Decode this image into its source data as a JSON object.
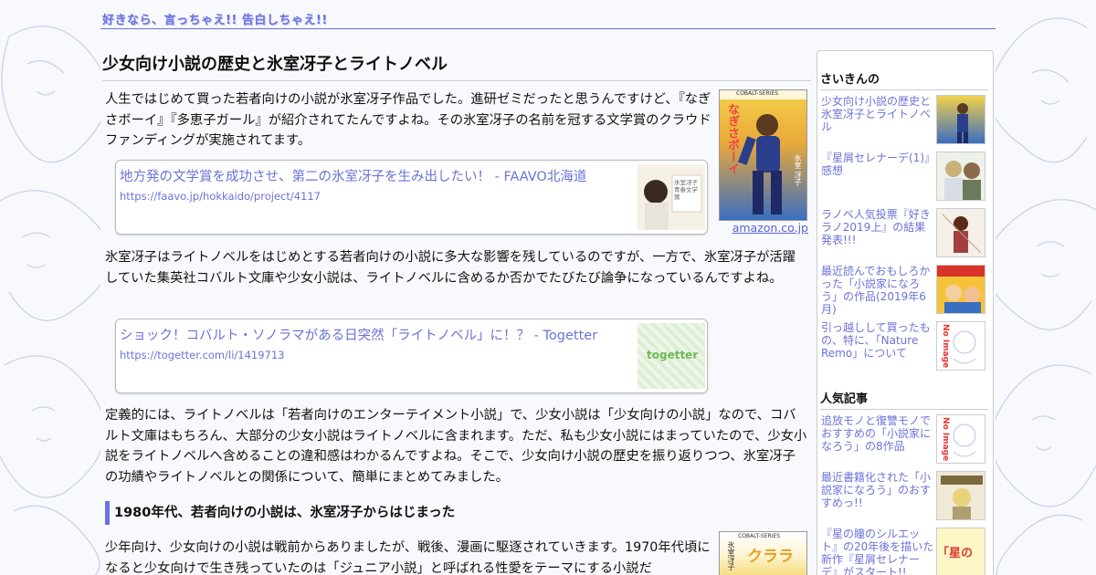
{
  "header": {
    "logo": "好きなら、言っちゃえ!! 告白しちゃえ!!"
  },
  "article": {
    "title": "少女向け小説の歴史と氷室冴子とライトノベル",
    "para1": "人生ではじめて買った若者向けの小説が氷室冴子作品でした。進研ゼミだったと思うんですけど、『なぎさボーイ』『多恵子ガール』が紹介されてたんですよね。その氷室冴子の名前を冠する文学賞のクラウドファンディングが実施されてます。",
    "book1": {
      "cover_title": "なぎさボーイ",
      "cover_series": "COBALT-SERIES",
      "cover_author": "氷室 冴子",
      "amazon": "amazon.co.jp"
    },
    "card1": {
      "title": "地方発の文学賞を成功させ、第二の氷室冴子を生み出したい！ - FAAVO北海道",
      "url": "https://faavo.jp/hokkaido/project/4117",
      "thumb_text": "氷室冴子青春文学賞"
    },
    "para2": "氷室冴子はライトノベルをはじめとする若者向けの小説に多大な影響を残しているのですが、一方で、氷室冴子が活躍していた集英社コバルト文庫や少女小説は、ライトノベルに含めるか否かでたびたび論争になっているんですよね。",
    "card2": {
      "title": "ショック！コバルト・ソノラマがある日突然「ライトノベル」に！？ - Togetter",
      "url": "https://togetter.com/li/1419713",
      "thumb_text": "togetter"
    },
    "para3": "定義的には、ライトノベルは「若者向けのエンターテイメント小説」で、少女小説は「少女向けの小説」なので、コバルト文庫はもちろん、大部分の少女小説はライトノベルに含まれます。ただ、私も少女小説にはまっていたので、少女小説をライトノベルへ含めることの違和感はわかるんですよね。そこで、少女向け小説の歴史を振り返りつつ、氷室冴子の功績やライトノベルとの関係について、簡単にまとめてみました。",
    "section1": "1980年代、若者向けの小説は、氷室冴子からはじまった",
    "para4": "少年向け、少女向けの小説は戦前からありましたが、戦後、漫画に駆逐されていきます。1970年代頃になると少女向けで生き残っていたのは「ジュニア小説」と呼ばれる性愛をテーマにする小説だ",
    "book2": {
      "cover_title": "クララ",
      "cover_series": "COBALT-SERIES",
      "cover_author": "氷室冴子"
    }
  },
  "sidebar": {
    "recent_title": "さいきんの",
    "recent": [
      {
        "text": "少女向け小説の歴史と氷室冴子とライトノベル"
      },
      {
        "text": "『星屑セレナーデ(1)』感想"
      },
      {
        "text": "ラノベ人気投票『好きラノ2019上』の結果発表!!!"
      },
      {
        "text": "最近読んでおもしろかった「小説家になろう」の作品(2019年6月)"
      },
      {
        "text": "引っ越しして買ったもの、特に、「Nature Remo」について",
        "thumb_label": "No Image"
      }
    ],
    "popular_title": "人気記事",
    "popular": [
      {
        "text": "追放モノと復讐モノでおすすめの「小説家になろう」の8作品",
        "thumb_label": "No Image"
      },
      {
        "text": "最近書籍化された「小説家になろう」のおすすめっ!!"
      },
      {
        "text": "『星の瞳のシルエット』の20年後を描いた新作『星屑セレナーデ』がスタート!!",
        "thumb_label": "「星の"
      }
    ]
  },
  "colors": {
    "accent": "#6a72e0",
    "link": "#6b72d8",
    "background": "#f8f9fd"
  }
}
